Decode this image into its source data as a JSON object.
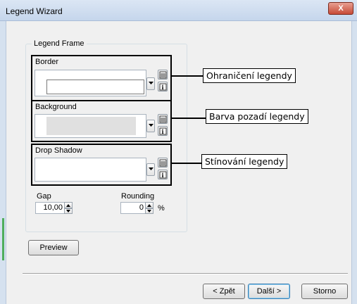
{
  "window": {
    "title": "Legend Wizard",
    "close_glyph": "X"
  },
  "frame": {
    "legend": "Legend Frame",
    "border_label": "Border",
    "background_label": "Background",
    "shadow_label": "Drop Shadow",
    "gap_label": "Gap",
    "gap_value": "10,00",
    "rounding_label": "Rounding",
    "rounding_value": "0",
    "rounding_unit": "%"
  },
  "callouts": {
    "border": "Ohraničení legendy",
    "background": "Barva pozadí legendy",
    "shadow": "Stínování legendy"
  },
  "buttons": {
    "preview": "Preview",
    "back": "< Zpět",
    "next": "Další >",
    "cancel": "Storno"
  },
  "icons": {
    "symbol_properties": "symbol-properties-icon",
    "symbol_info": "symbol-info-icon",
    "dropdown": "chevron-down-icon",
    "spin_up": "spin-up-icon",
    "spin_down": "spin-down-icon"
  }
}
